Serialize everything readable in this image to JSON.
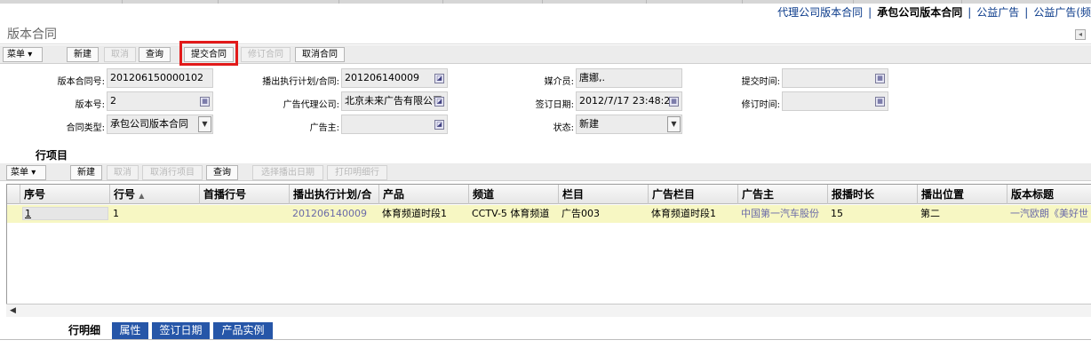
{
  "top_nav": {
    "items": [
      {
        "label": "代理公司版本合同",
        "active": false
      },
      {
        "label": "承包公司版本合同",
        "active": true
      },
      {
        "label": "公益广告",
        "active": false
      },
      {
        "label": "公益广告(频",
        "active": false
      }
    ],
    "separator": "|"
  },
  "page_title": "版本合同",
  "toolbar": {
    "menu_label": "菜单",
    "buttons": [
      {
        "label": "新建",
        "enabled": true
      },
      {
        "label": "取消",
        "enabled": false
      },
      {
        "label": "查询",
        "enabled": true
      },
      {
        "label": "提交合同",
        "enabled": true,
        "highlighted": true
      },
      {
        "label": "修订合同",
        "enabled": false
      },
      {
        "label": "取消合同",
        "enabled": true
      }
    ]
  },
  "form": {
    "contract_no": {
      "label": "版本合同号:",
      "value": "201206150000102"
    },
    "version_no": {
      "label": "版本号:",
      "value": "2"
    },
    "contract_type": {
      "label": "合同类型:",
      "value": "承包公司版本合同"
    },
    "exec_plan": {
      "label": "播出执行计划/合同:",
      "value": "201206140009"
    },
    "ad_agency": {
      "label": "广告代理公司:",
      "value": "北京未来广告有限公司"
    },
    "advertiser": {
      "label": "广告主:",
      "value": ""
    },
    "media_person": {
      "label": "媒介员:",
      "value": "唐娜,."
    },
    "sign_date": {
      "label": "签订日期:",
      "value": "2012/7/17 23:48:25"
    },
    "status": {
      "label": "状态:",
      "value": "新建"
    },
    "submit_time": {
      "label": "提交时间:",
      "value": ""
    },
    "revise_time": {
      "label": "修订时间:",
      "value": ""
    }
  },
  "line_items": {
    "section_title": "行项目",
    "toolbar": {
      "menu_label": "菜单",
      "buttons": [
        {
          "label": "新建",
          "enabled": true
        },
        {
          "label": "取消",
          "enabled": false
        },
        {
          "label": "取消行项目",
          "enabled": false
        },
        {
          "label": "查询",
          "enabled": true
        },
        {
          "label": "选择播出日期",
          "enabled": false
        },
        {
          "label": "打印明细行",
          "enabled": false
        }
      ]
    },
    "columns": [
      "序号",
      "行号",
      "首播行号",
      "播出执行计划/合",
      "产品",
      "频道",
      "栏目",
      "广告栏目",
      "广告主",
      "报播时长",
      "播出位置",
      "版本标题"
    ],
    "sort_indicator": "▲",
    "rows": [
      {
        "seq": "1",
        "line_no": "1",
        "first_line_no": "",
        "exec_plan": "201206140009",
        "product": "体育频道时段1",
        "channel": "CCTV-5 体育频道",
        "program": "广告003",
        "ad_program": "体育频道时段1",
        "advertiser": "中国第一汽车股份",
        "duration": "15",
        "position": "第二",
        "version_title": "一汽欧朗《美好世"
      }
    ]
  },
  "bottom_tabs": [
    {
      "label": "行明细",
      "active": true
    },
    {
      "label": "属性",
      "active": false
    },
    {
      "label": "签订日期",
      "active": false
    },
    {
      "label": "产品实例",
      "active": false
    }
  ]
}
